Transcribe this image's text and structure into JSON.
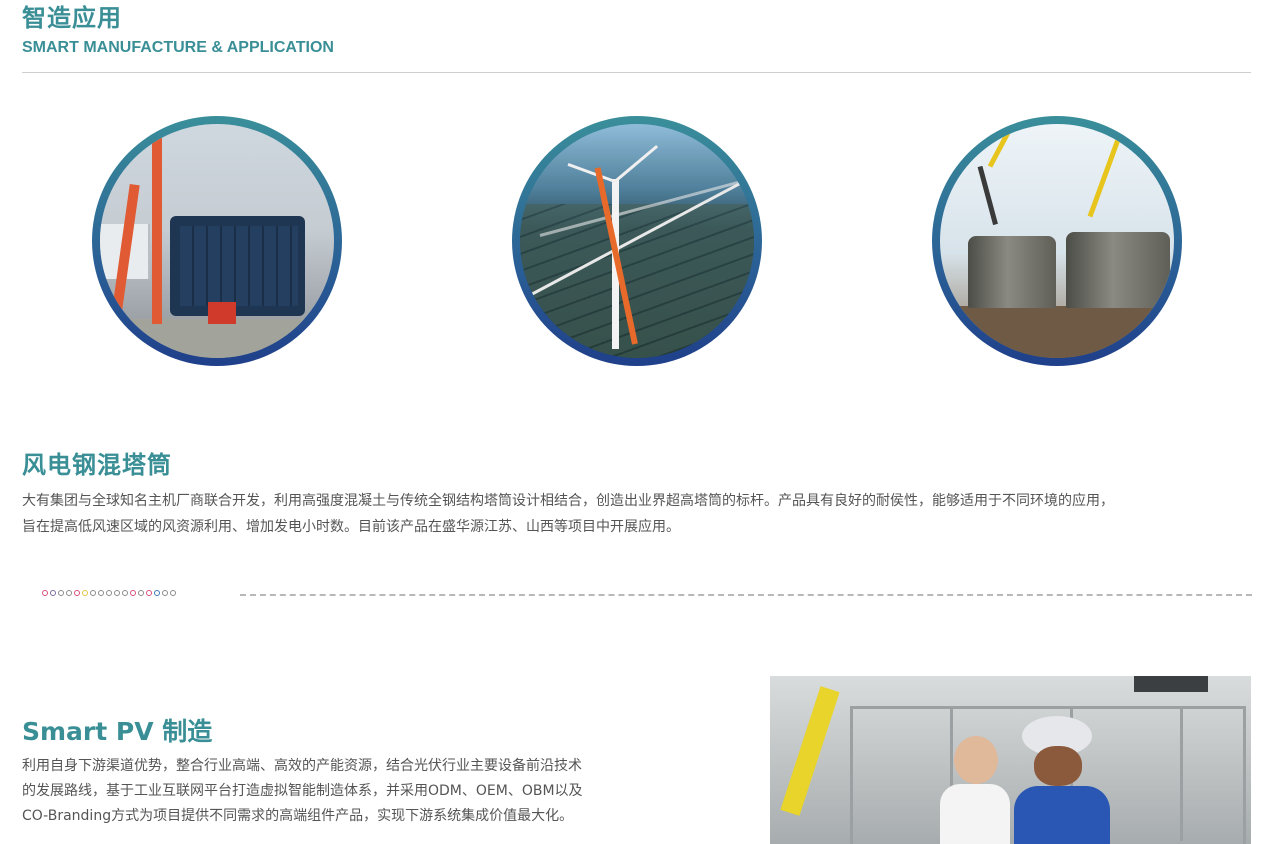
{
  "header": {
    "title_cn": "智造应用",
    "title_en": "SMART MANUFACTURE & APPLICATION"
  },
  "circles": [
    {
      "icon": "steel-formwork-photo"
    },
    {
      "icon": "wind-turbine-aerial-photo"
    },
    {
      "icon": "concrete-tower-crane-photo"
    }
  ],
  "section1": {
    "title": "风电钢混塔筒",
    "text_line1": "大有集团与全球知名主机厂商联合开发，利用高强度混凝土与传统全钢结构塔筒设计相结合，创造出业界超高塔筒的标杆。产品具有良好的耐侯性，能够适用于不同环境的应用，",
    "text_line2": "旨在提高低风速区域的风资源利用、增加发电小时数。目前该产品在盛华源江苏、山西等项目中开展应用。"
  },
  "divider": {
    "dot_colors": [
      "#d8507a",
      "#7a6aa0",
      "#8a8a8a",
      "#8a8a8a",
      "#d8507a",
      "#e0c640",
      "#8a8a8a",
      "#8a8a8a",
      "#8a8a8a",
      "#8a8a8a",
      "#8a8a8a",
      "#d8507a",
      "#8a8a8a",
      "#d8507a",
      "#3a7ab8",
      "#8a8a8a",
      "#8a8a8a"
    ]
  },
  "section2": {
    "title": "Smart PV 制造",
    "text_line1": "利用自身下游渠道优势，整合行业高端、高效的产能资源，结合光伏行业主要设备前沿技术",
    "text_line2": "的发展路线，基于工业互联网平台打造虚拟智能制造体系，并采用ODM、OEM、OBM以及",
    "text_line3": "CO-Branding方式为项目提供不同需求的高端组件产品，实现下游系统集成价值最大化。",
    "photo_icon": "pv-factory-workers-photo"
  }
}
